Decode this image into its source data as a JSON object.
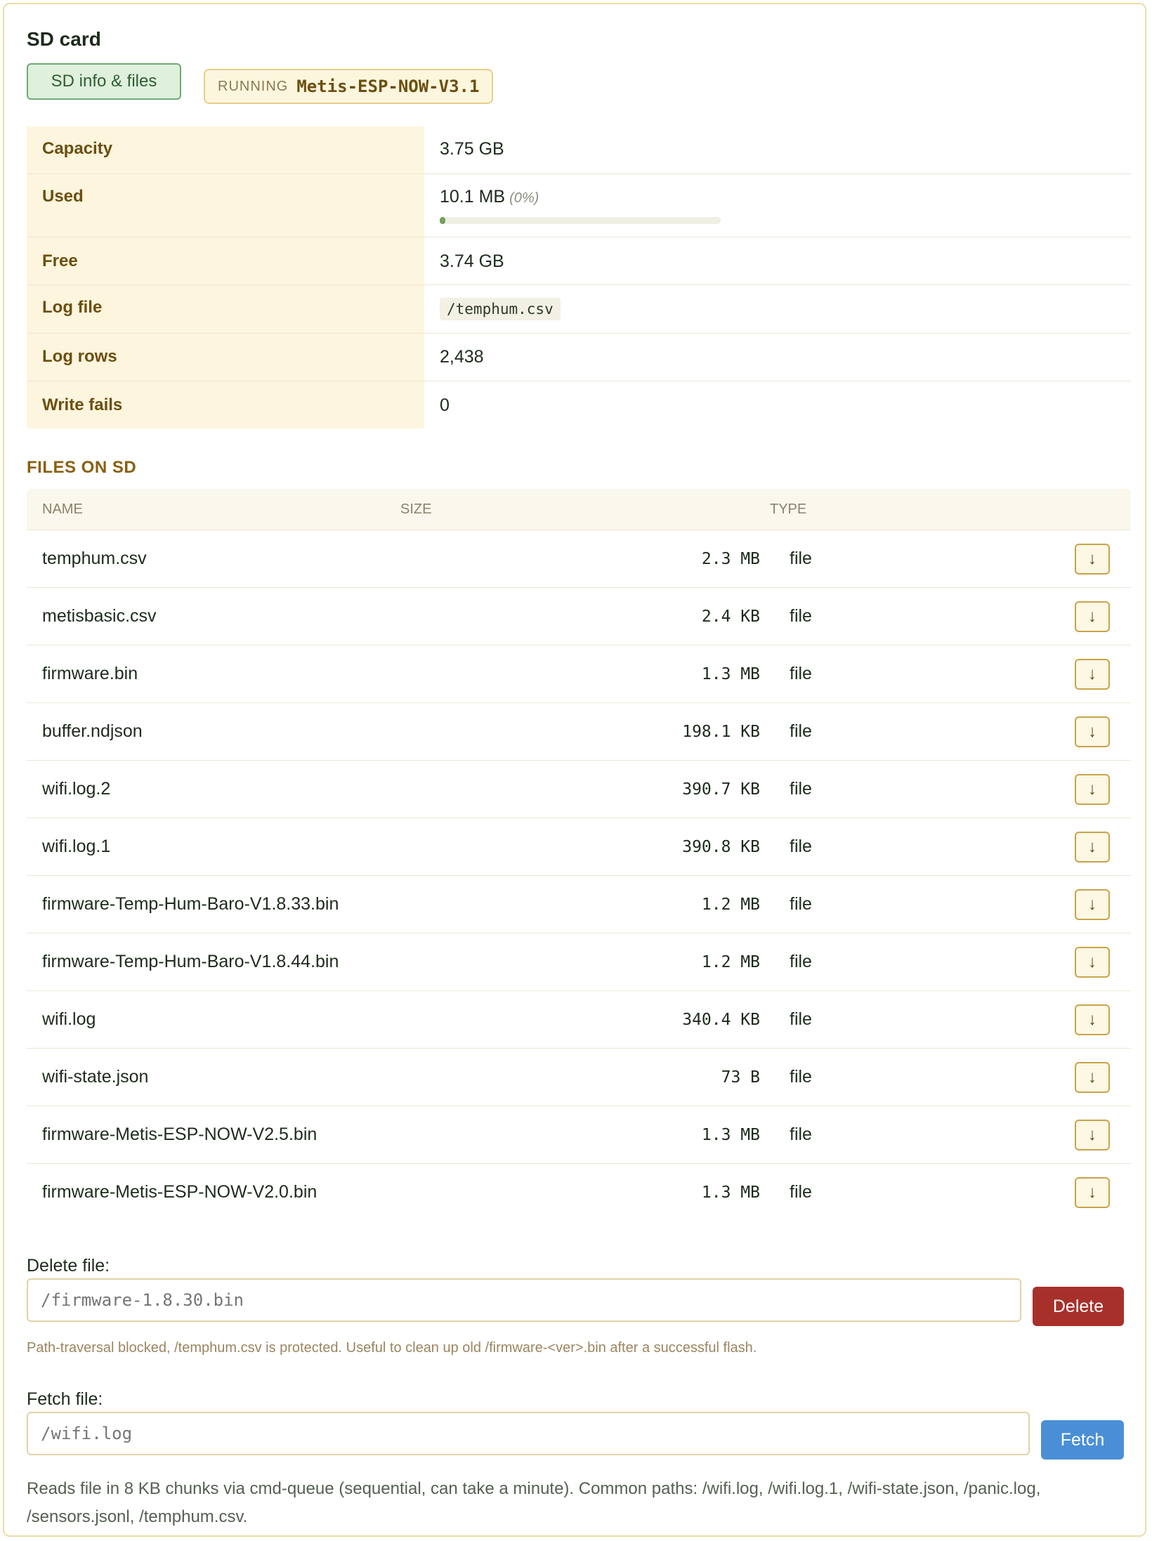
{
  "title": "SD card",
  "tab": {
    "label": "SD info & files"
  },
  "running": {
    "label": "RUNNING",
    "firmware": "Metis-ESP-NOW-V3.1"
  },
  "info": {
    "capacity": {
      "label": "Capacity",
      "value": "3.75 GB"
    },
    "used": {
      "label": "Used",
      "value": "10.1 MB",
      "percent_text": "(0%)",
      "percent": 0
    },
    "free": {
      "label": "Free",
      "value": "3.74 GB"
    },
    "log_file": {
      "label": "Log file",
      "value": "/temphum.csv"
    },
    "log_rows": {
      "label": "Log rows",
      "value": "2,438"
    },
    "write_fails": {
      "label": "Write fails",
      "value": "0"
    }
  },
  "files_section": {
    "title": "FILES ON SD",
    "columns": {
      "name": "NAME",
      "size": "SIZE",
      "type": "TYPE"
    },
    "download_icon": "↓",
    "rows": [
      {
        "name": "temphum.csv",
        "size": "2.3 MB",
        "type": "file"
      },
      {
        "name": "metisbasic.csv",
        "size": "2.4 KB",
        "type": "file"
      },
      {
        "name": "firmware.bin",
        "size": "1.3 MB",
        "type": "file"
      },
      {
        "name": "buffer.ndjson",
        "size": "198.1 KB",
        "type": "file"
      },
      {
        "name": "wifi.log.2",
        "size": "390.7 KB",
        "type": "file"
      },
      {
        "name": "wifi.log.1",
        "size": "390.8 KB",
        "type": "file"
      },
      {
        "name": "firmware-Temp-Hum-Baro-V1.8.33.bin",
        "size": "1.2 MB",
        "type": "file"
      },
      {
        "name": "firmware-Temp-Hum-Baro-V1.8.44.bin",
        "size": "1.2 MB",
        "type": "file"
      },
      {
        "name": "wifi.log",
        "size": "340.4 KB",
        "type": "file"
      },
      {
        "name": "wifi-state.json",
        "size": "73 B",
        "type": "file"
      },
      {
        "name": "firmware-Metis-ESP-NOW-V2.5.bin",
        "size": "1.3 MB",
        "type": "file"
      },
      {
        "name": "firmware-Metis-ESP-NOW-V2.0.bin",
        "size": "1.3 MB",
        "type": "file"
      }
    ]
  },
  "delete": {
    "label": "Delete file:",
    "placeholder": "/firmware-1.8.30.bin",
    "button": "Delete",
    "help": "Path-traversal blocked, /temphum.csv is protected. Useful to clean up old /firmware-<ver>.bin after a successful flash."
  },
  "fetch": {
    "label": "Fetch file:",
    "placeholder": "/wifi.log",
    "button": "Fetch",
    "help": "Reads file in 8 KB chunks via cmd-queue (sequential, can take a minute). Common paths: /wifi.log, /wifi.log.1, /wifi-state.json, /panic.log, /sensors.jsonl, /temphum.csv."
  }
}
